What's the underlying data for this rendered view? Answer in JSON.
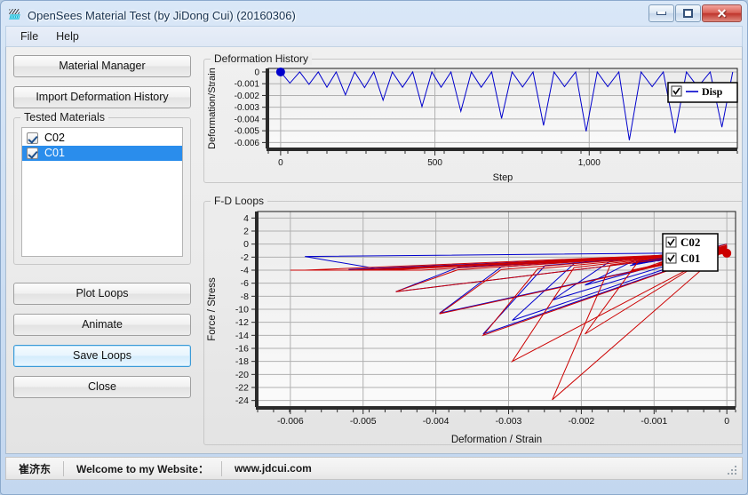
{
  "window": {
    "title": "OpenSees Material Test (by JiDong Cui) (20160306)",
    "icon": "app-icon",
    "controls": {
      "minimize": "minimize-button",
      "maximize": "maximize-button",
      "close": "✕"
    }
  },
  "menubar": {
    "items": [
      {
        "label": "File"
      },
      {
        "label": "Help"
      }
    ]
  },
  "left_panel": {
    "buttons_top": [
      {
        "label": "Material Manager",
        "name": "material-manager-button"
      },
      {
        "label": "Import Deformation History",
        "name": "import-deformation-history-button"
      }
    ],
    "tested_materials": {
      "group_label": "Tested Materials",
      "items": [
        {
          "label": "C02",
          "checked": true,
          "selected": false
        },
        {
          "label": "C01",
          "checked": true,
          "selected": true
        }
      ]
    },
    "buttons_bottom": [
      {
        "label": "Plot Loops",
        "name": "plot-loops-button",
        "focused": false
      },
      {
        "label": "Animate",
        "name": "animate-button",
        "focused": false
      },
      {
        "label": "Save Loops",
        "name": "save-loops-button",
        "focused": true
      },
      {
        "label": "Close",
        "name": "close-button",
        "focused": false
      }
    ]
  },
  "statusbar": {
    "author": "崔济东",
    "welcome": "Welcome to my Website：",
    "website": "www.jdcui.com"
  },
  "colors": {
    "series_blue": "#0000cc",
    "series_red": "#cc0000",
    "grid": "#b0b0b0",
    "plot_bg_top": "#ebebeb",
    "plot_bg_bottom": "#fbfbfb",
    "selection_blue": "#2a8dec",
    "focus_blue": "#3c9ad6"
  },
  "chart_data": [
    {
      "name": "deformation-history-chart",
      "type": "line",
      "title": "Deformation History",
      "xlabel": "Step",
      "ylabel": "Deformation/Strain",
      "xlim": [
        -40,
        1480
      ],
      "ylim": [
        -0.0065,
        0.0003
      ],
      "xticks": [
        0,
        500,
        1000
      ],
      "xticklabels": [
        "0",
        "500",
        "1,000"
      ],
      "yticks": [
        0,
        -0.001,
        -0.002,
        -0.003,
        -0.004,
        -0.005,
        -0.006
      ],
      "yticklabels": [
        "0",
        "-0.001",
        "-0.002",
        "-0.003",
        "-0.004",
        "-0.005",
        "-0.006"
      ],
      "grid": true,
      "legend": {
        "position": "top-right",
        "entries": [
          {
            "label": "Disp",
            "color": "#0000cc",
            "checked": true
          }
        ]
      },
      "marker": {
        "x": 0,
        "y": 0,
        "color": "#0000cc",
        "label": "start-point"
      },
      "series": [
        {
          "name": "Disp",
          "color": "#0000cc",
          "comment": "cyclic triangular displacement history, amplitude grows; x=step, y=strain",
          "x": [
            0,
            30,
            62,
            92,
            122,
            150,
            180,
            210,
            240,
            272,
            302,
            332,
            362,
            395,
            428,
            458,
            490,
            520,
            552,
            584,
            618,
            650,
            684,
            716,
            750,
            784,
            818,
            852,
            886,
            920,
            956,
            990,
            1026,
            1060,
            1096,
            1130,
            1168,
            1204,
            1240,
            1278,
            1315,
            1352,
            1392,
            1430,
            1465
          ],
          "y": [
            0,
            -0.00095,
            0,
            -0.00105,
            0,
            -0.0013,
            0,
            -0.00195,
            0,
            -0.00133,
            0,
            -0.0024,
            0,
            -0.0013,
            0,
            -0.00295,
            0,
            -0.0013,
            0,
            -0.00335,
            0,
            -0.0013,
            0,
            -0.00395,
            0,
            -0.00128,
            0,
            -0.00455,
            0,
            -0.00125,
            0,
            -0.00505,
            0,
            -0.00125,
            0,
            -0.0058,
            0,
            -0.00125,
            0,
            -0.0052,
            0,
            -0.00128,
            0,
            -0.0047,
            0
          ]
        }
      ]
    },
    {
      "name": "fd-loops-chart",
      "type": "line",
      "title": "F-D Loops",
      "xlabel": "Deformation / Strain",
      "ylabel": "Force / Stress",
      "xlim": [
        -0.00645,
        0.00012
      ],
      "ylim": [
        -25,
        5
      ],
      "xticks": [
        -0.006,
        -0.005,
        -0.004,
        -0.003,
        -0.002,
        -0.001,
        0
      ],
      "xticklabels": [
        "-0.006",
        "-0.005",
        "-0.004",
        "-0.003",
        "-0.002",
        "-0.001",
        "0"
      ],
      "yticks": [
        4,
        2,
        0,
        -2,
        -4,
        -6,
        -8,
        -10,
        -12,
        -14,
        -16,
        -18,
        -20,
        -22,
        -24
      ],
      "yticklabels": [
        "4",
        "2",
        "0",
        "-2",
        "-4",
        "-6",
        "-8",
        "-10",
        "-12",
        "-14",
        "-16",
        "-18",
        "-20",
        "-22",
        "-24"
      ],
      "grid": true,
      "legend": {
        "position": "right",
        "entries": [
          {
            "label": "C02",
            "color": "#cc0000",
            "checked": true
          },
          {
            "label": "C01",
            "color": "#0000cc",
            "checked": true
          }
        ]
      },
      "marker": {
        "x": 0,
        "y": -1.4,
        "color": "#cc0000",
        "label": "current-point"
      },
      "series": [
        {
          "name": "C01",
          "color": "#0000cc",
          "comment": "concrete hysteresis loops, blue material; pairs of unload/reload branches",
          "loops": [
            [
              [
                0,
                0
              ],
              [
                -0.00095,
                -2.6
              ],
              [
                0,
                -0.25
              ]
            ],
            [
              [
                0,
                -0.25
              ],
              [
                -0.00105,
                -2.75
              ],
              [
                0,
                -0.3
              ]
            ],
            [
              [
                0,
                -0.3
              ],
              [
                -0.0013,
                -3.1
              ],
              [
                -0.0004,
                -1.0
              ],
              [
                0,
                -0.35
              ]
            ],
            [
              [
                0,
                -0.35
              ],
              [
                -0.00195,
                -6.3
              ],
              [
                -0.0012,
                -2.1
              ],
              [
                0,
                -0.45
              ]
            ],
            [
              [
                0,
                -0.45
              ],
              [
                -0.00133,
                -3.3
              ],
              [
                0,
                -0.5
              ]
            ],
            [
              [
                0,
                -0.5
              ],
              [
                -0.0024,
                -8.6
              ],
              [
                -0.0016,
                -2.6
              ],
              [
                0,
                -0.6
              ]
            ],
            [
              [
                0,
                -0.6
              ],
              [
                -0.0013,
                -3.2
              ],
              [
                0,
                -0.65
              ]
            ],
            [
              [
                0,
                -0.65
              ],
              [
                -0.00295,
                -11.7
              ],
              [
                -0.0021,
                -3.0
              ],
              [
                0,
                -0.8
              ]
            ],
            [
              [
                0,
                -0.8
              ],
              [
                -0.0013,
                -3.1
              ],
              [
                0,
                -0.85
              ]
            ],
            [
              [
                0,
                -0.85
              ],
              [
                -0.00335,
                -13.8
              ],
              [
                -0.0025,
                -3.3
              ],
              [
                0,
                -0.95
              ]
            ],
            [
              [
                0,
                -0.95
              ],
              [
                -0.0013,
                -3.0
              ],
              [
                0,
                -1.0
              ]
            ],
            [
              [
                0,
                -1.0
              ],
              [
                -0.00395,
                -10.6
              ],
              [
                -0.0031,
                -3.5
              ],
              [
                0,
                -1.1
              ]
            ],
            [
              [
                0,
                -1.1
              ],
              [
                -0.00128,
                -2.9
              ],
              [
                0,
                -1.15
              ]
            ],
            [
              [
                0,
                -1.15
              ],
              [
                -0.00455,
                -7.3
              ],
              [
                -0.0037,
                -3.6
              ],
              [
                0,
                -1.2
              ]
            ],
            [
              [
                0,
                -1.2
              ],
              [
                -0.00125,
                -2.8
              ],
              [
                0,
                -1.25
              ]
            ],
            [
              [
                0,
                -1.25
              ],
              [
                -0.00505,
                -4.0
              ],
              [
                -0.0042,
                -3.7
              ],
              [
                0,
                -1.3
              ]
            ],
            [
              [
                0,
                -1.3
              ],
              [
                -0.00125,
                -2.7
              ],
              [
                0,
                -1.3
              ]
            ],
            [
              [
                0,
                -1.3
              ],
              [
                -0.0058,
                -1.9
              ],
              [
                -0.0048,
                -3.8
              ],
              [
                0,
                -1.35
              ]
            ],
            [
              [
                0,
                -1.35
              ],
              [
                -0.00125,
                -2.6
              ],
              [
                0,
                -1.35
              ]
            ],
            [
              [
                0,
                -1.35
              ],
              [
                -0.0052,
                -3.9
              ],
              [
                0,
                -1.4
              ]
            ],
            [
              [
                0,
                -1.4
              ],
              [
                -0.0047,
                -3.9
              ],
              [
                0,
                -1.4
              ]
            ]
          ]
        },
        {
          "name": "C02",
          "color": "#cc0000",
          "comment": "concrete hysteresis loops, red material; envelope peaks at about -24 at -0.002",
          "loops": [
            [
              [
                0,
                0
              ],
              [
                -0.00095,
                -3.0
              ],
              [
                0,
                -0.2
              ]
            ],
            [
              [
                0,
                -0.2
              ],
              [
                -0.00105,
                -3.5
              ],
              [
                0,
                -0.3
              ]
            ],
            [
              [
                0,
                -0.3
              ],
              [
                -0.0013,
                -4.3
              ],
              [
                -0.0005,
                -1.2
              ],
              [
                0,
                -0.4
              ]
            ],
            [
              [
                0,
                -0.4
              ],
              [
                -0.00195,
                -13.8
              ],
              [
                -0.0012,
                -2.4
              ],
              [
                0,
                -0.5
              ]
            ],
            [
              [
                0,
                -0.5
              ],
              [
                -0.00133,
                -4.2
              ],
              [
                0,
                -0.55
              ]
            ],
            [
              [
                0,
                -0.55
              ],
              [
                -0.0024,
                -23.9
              ],
              [
                -0.0016,
                -3.2
              ],
              [
                0,
                -0.7
              ]
            ],
            [
              [
                0,
                -0.7
              ],
              [
                -0.0013,
                -4.1
              ],
              [
                0,
                -0.75
              ]
            ],
            [
              [
                0,
                -0.75
              ],
              [
                -0.00295,
                -18.0
              ],
              [
                -0.0021,
                -3.6
              ],
              [
                0,
                -0.85
              ]
            ],
            [
              [
                0,
                -0.85
              ],
              [
                -0.0013,
                -4.0
              ],
              [
                0,
                -0.9
              ]
            ],
            [
              [
                0,
                -0.9
              ],
              [
                -0.00335,
                -14.0
              ],
              [
                -0.0026,
                -3.8
              ],
              [
                0,
                -1.0
              ]
            ],
            [
              [
                0,
                -1.0
              ],
              [
                -0.0013,
                -4.0
              ],
              [
                0,
                -1.05
              ]
            ],
            [
              [
                0,
                -1.05
              ],
              [
                -0.00395,
                -10.7
              ],
              [
                -0.0031,
                -3.9
              ],
              [
                0,
                -1.1
              ]
            ],
            [
              [
                0,
                -1.1
              ],
              [
                -0.00128,
                -4.0
              ],
              [
                0,
                -1.15
              ]
            ],
            [
              [
                0,
                -1.15
              ],
              [
                -0.00455,
                -7.3
              ],
              [
                -0.0037,
                -3.95
              ],
              [
                0,
                -1.2
              ]
            ],
            [
              [
                0,
                -1.2
              ],
              [
                -0.00125,
                -4.0
              ],
              [
                0,
                -1.25
              ]
            ],
            [
              [
                0,
                -1.25
              ],
              [
                -0.00505,
                -4.0
              ],
              [
                -0.0042,
                -4.0
              ],
              [
                0,
                -1.3
              ]
            ],
            [
              [
                0,
                -1.3
              ],
              [
                -0.00125,
                -4.0
              ],
              [
                0,
                -1.3
              ]
            ],
            [
              [
                0,
                -1.3
              ],
              [
                -0.0058,
                -4.0
              ],
              [
                -0.006,
                -4.0
              ],
              [
                -0.0048,
                -4.0
              ],
              [
                0,
                -1.35
              ]
            ],
            [
              [
                0,
                -1.35
              ],
              [
                -0.00125,
                -4.0
              ],
              [
                0,
                -1.35
              ]
            ],
            [
              [
                0,
                -1.35
              ],
              [
                -0.0052,
                -4.0
              ],
              [
                0,
                -1.4
              ]
            ],
            [
              [
                0,
                -1.4
              ],
              [
                -0.0047,
                -4.0
              ],
              [
                0,
                -1.4
              ]
            ]
          ]
        }
      ]
    }
  ]
}
